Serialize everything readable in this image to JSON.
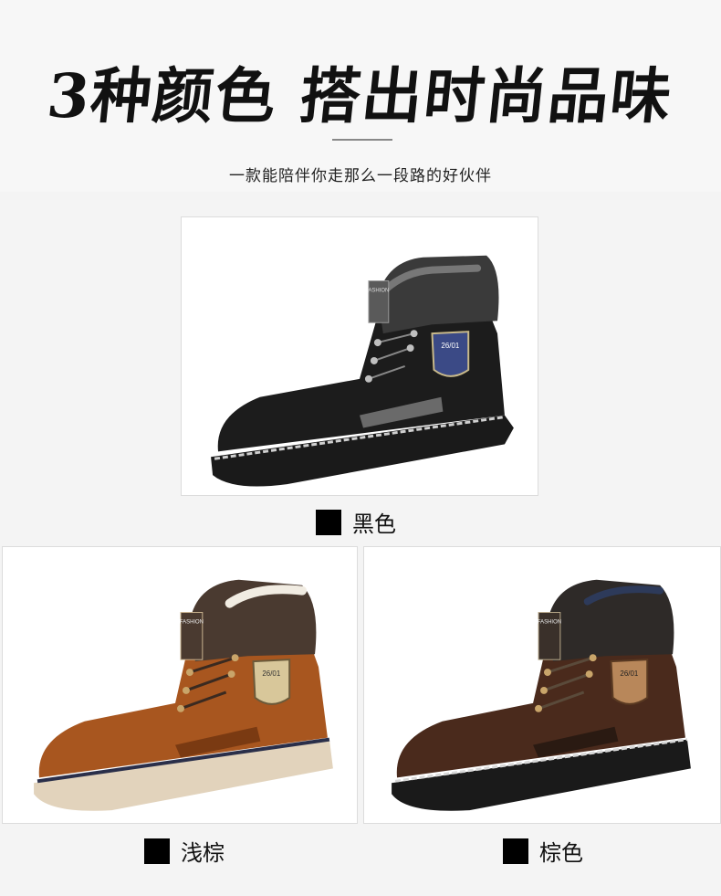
{
  "header": {
    "headline": "3种颜色 搭出时尚品味",
    "subtitle": "一款能陪伴你走那么一段路的好伙伴"
  },
  "products": [
    {
      "color_name": "黑色",
      "leather": "#1c1c1c",
      "collar": "#3a3a3a",
      "badge_text": "26/01",
      "tag_text": "ASHION"
    },
    {
      "color_name": "浅棕",
      "leather": "#a8561f",
      "collar": "#4a3a30",
      "badge_text": "26/01",
      "tag_text": "FASHION"
    },
    {
      "color_name": "棕色",
      "leather": "#4a2a1c",
      "collar": "#2e2a28",
      "badge_text": "26/01",
      "tag_text": "FASHION"
    }
  ]
}
